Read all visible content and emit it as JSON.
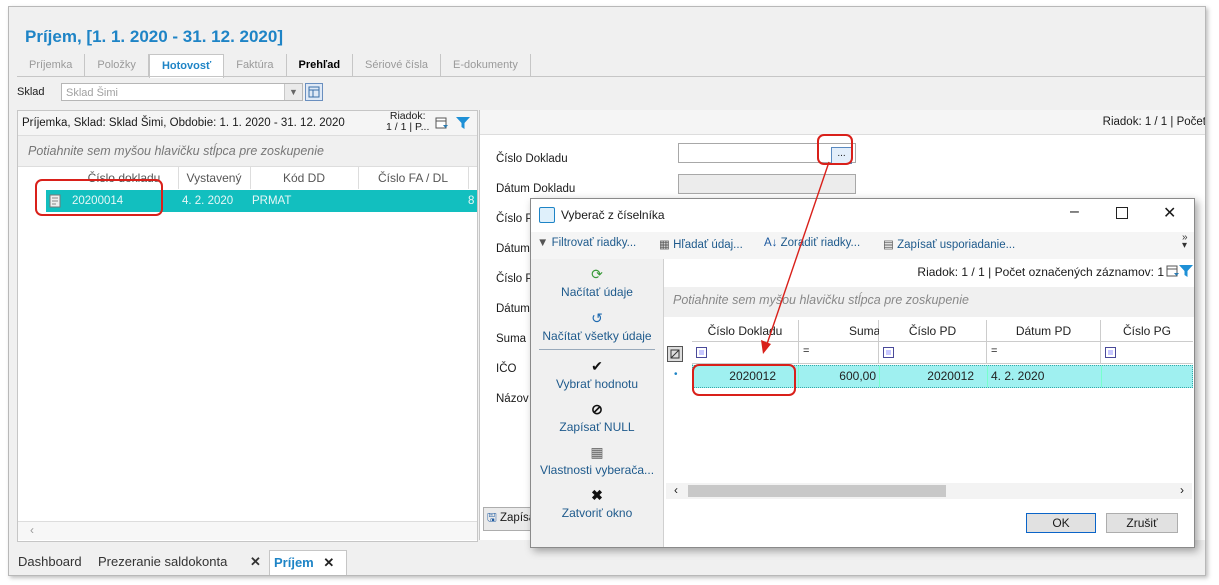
{
  "window": {
    "title": "Príjem,  [1. 1. 2020 - 31. 12. 2020]",
    "tabs": [
      {
        "label": "Príjemka"
      },
      {
        "label": "Položky"
      },
      {
        "label": "Hotovosť"
      },
      {
        "label": "Faktúra"
      },
      {
        "label": "Prehľad"
      },
      {
        "label": "Sériové čísla"
      },
      {
        "label": "E-dokumenty"
      }
    ],
    "active_tab": "Hotovosť"
  },
  "filter": {
    "sklad_label": "Sklad",
    "sklad_value": "Sklad Šimi"
  },
  "left_panel": {
    "header": "Príjemka, Sklad: Sklad Šimi, Obdobie: 1. 1. 2020 - 31. 12. 2020",
    "row_info_1": "Riadok:",
    "row_info_2": "1 / 1 | P...",
    "group_hint": "Potiahnite sem myšou hlavičku stĺpca pre zoskupenie",
    "columns": [
      "Číslo dokladu",
      "Vystavený",
      "Kód DD",
      "Číslo FA / DL"
    ],
    "rows": [
      {
        "cislo": "20200014",
        "vystaveny": "4. 2. 2020",
        "kod_dd": "PRMAT",
        "cislo_fa": "8"
      }
    ]
  },
  "right_panel": {
    "row_info": "Riadok: 1 / 1 | Počet",
    "fields": [
      {
        "label": "Číslo Dokladu"
      },
      {
        "label": "Dátum Dokladu"
      },
      {
        "label": "Číslo PD"
      },
      {
        "label": "Dátum PD"
      },
      {
        "label": "Číslo PG"
      },
      {
        "label": "Dátum PG"
      },
      {
        "label": "Suma"
      },
      {
        "label": "IČO"
      },
      {
        "label": "Názov Fir"
      }
    ],
    "browse_button": "...",
    "save_button": "Zapísať"
  },
  "dialog": {
    "title": "Vyberač z číselníka",
    "toolbar": {
      "filter": "Filtrovať riadky...",
      "find": "Hľadať údaj...",
      "sort": "Zoradiť riadky...",
      "save_order": "Zapísať usporiadanie..."
    },
    "sidebar": {
      "load": "Načítať údaje",
      "load_all": "Načítať všetky údaje",
      "select": "Vybrať hodnotu",
      "write_null": "Zapísať NULL",
      "properties": "Vlastnosti vyberača...",
      "close": "Zatvoriť okno"
    },
    "row_info": "Riadok: 1 / 1 | Počet označených záznamov: 1",
    "group_hint": "Potiahnite sem myšou hlavičku stĺpca pre zoskupenie",
    "columns": [
      "Číslo Dokladu",
      "Suma",
      "Číslo PD",
      "Dátum PD",
      "Číslo PG"
    ],
    "filter_ops": [
      "=",
      "="
    ],
    "rows": [
      {
        "cislo_dokladu": "2020012",
        "suma": "600,00",
        "cislo_pd": "2020012",
        "datum_pd": "4. 2. 2020",
        "cislo_pg": ""
      }
    ],
    "ok": "OK",
    "cancel": "Zrušiť"
  },
  "bottom_tabs": [
    {
      "label": "Dashboard"
    },
    {
      "label": "Prezeranie saldokonta"
    },
    {
      "label": "Príjem"
    }
  ],
  "colors": {
    "accent": "#1e84c6",
    "selected_row": "#12bfbf",
    "dialog_row": "#9ff0f0",
    "highlight": "#d9201a"
  }
}
